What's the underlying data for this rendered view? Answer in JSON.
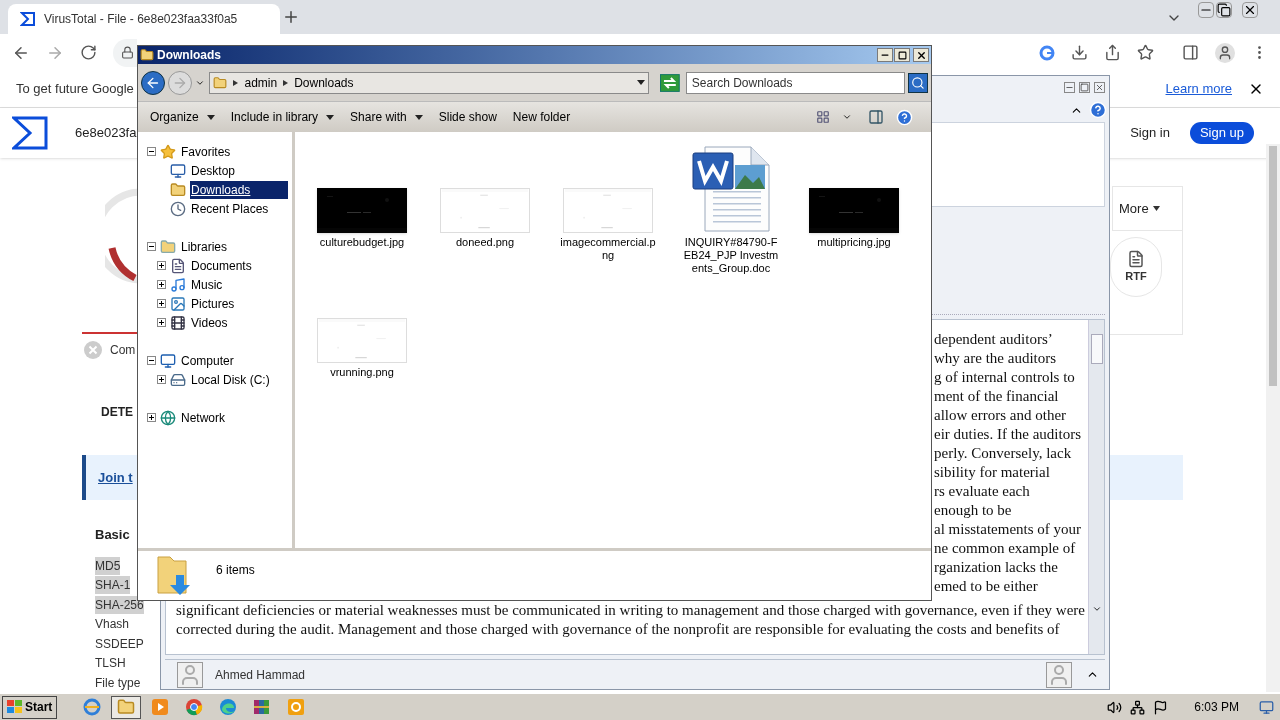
{
  "browser": {
    "tab_title": "VirusTotal - File - 6e8e023faa33f0a5",
    "infobar": {
      "message": "To get future Google",
      "link": "Learn more"
    },
    "page": {
      "file_hash": "6e8e023fa",
      "sign_in": "Sign in",
      "sign_up": "Sign up",
      "more_menu": "More",
      "file_type_badge": "RTF",
      "community_label": "Com",
      "detection_tab": "DETE",
      "join_link": "Join t",
      "section_title": "Basic",
      "fields": [
        {
          "label": "MD5",
          "highlighted": true
        },
        {
          "label": "SHA-1",
          "highlighted": true
        },
        {
          "label": "SHA-256",
          "highlighted": true
        },
        {
          "label": "Vhash",
          "highlighted": false
        },
        {
          "label": "SSDEEP",
          "highlighted": false
        },
        {
          "label": "TLSH",
          "highlighted": false
        },
        {
          "label": "File type",
          "highlighted": false
        }
      ]
    }
  },
  "document_window": {
    "partial_lines": [
      "dependent auditors’",
      "why are the auditors",
      "g of internal controls to",
      "ment of the financial",
      "allow errors and other",
      "eir duties. If the auditors",
      "perly. Conversely, lack",
      "sibility for material",
      "rs evaluate each",
      "enough to be",
      "al misstatements of your",
      "ne common example of",
      "rganization lacks the",
      "emed to be either"
    ],
    "lines": [
      "significant deficiencies or material weaknesses must be communicated in writing to management and those charged with governance, even if they were",
      "corrected during the audit. Management and those charged with governance of the nonprofit are responsible for evaluating the costs and benefits of"
    ],
    "author": "Ahmed Hammad"
  },
  "explorer": {
    "title": "Downloads",
    "breadcrumb": [
      "admin",
      "Downloads"
    ],
    "search": {
      "placeholder": "Search Downloads"
    },
    "toolbar": [
      {
        "label": "Organize",
        "dropdown": true
      },
      {
        "label": "Include in library",
        "dropdown": true
      },
      {
        "label": "Share with",
        "dropdown": true
      },
      {
        "label": "Slide show",
        "dropdown": false
      },
      {
        "label": "New folder",
        "dropdown": false
      }
    ],
    "nav": [
      {
        "label": "Favorites",
        "expanded": true,
        "selected": false,
        "children": [
          {
            "label": "Desktop",
            "selected": false
          },
          {
            "label": "Downloads",
            "selected": true
          },
          {
            "label": "Recent Places",
            "selected": false
          }
        ]
      },
      {
        "label": "Libraries",
        "expanded": true,
        "selected": false,
        "children": [
          {
            "label": "Documents",
            "expanded": false,
            "selected": false
          },
          {
            "label": "Music",
            "expanded": false,
            "selected": false
          },
          {
            "label": "Pictures",
            "expanded": false,
            "selected": false
          },
          {
            "label": "Videos",
            "expanded": false,
            "selected": false
          }
        ]
      },
      {
        "label": "Computer",
        "expanded": true,
        "selected": false,
        "children": [
          {
            "label": "Local Disk (C:)",
            "expanded": false,
            "selected": false
          }
        ]
      },
      {
        "label": "Network",
        "expanded": false,
        "selected": false
      }
    ],
    "files": [
      {
        "name": "culturebudget.jpg",
        "kind": "dark_image"
      },
      {
        "name": "doneed.png",
        "kind": "light_image"
      },
      {
        "name": "imagecommercial.png",
        "kind": "light_image"
      },
      {
        "name": "INQUIRY#84790-FEB24_PJP Investments_Group.doc",
        "kind": "document"
      },
      {
        "name": "multipricing.jpg",
        "kind": "dark_image"
      },
      {
        "name": "vrunning.png",
        "kind": "light_image"
      }
    ],
    "status": "6 items"
  },
  "taskbar": {
    "start": "Start",
    "apps": [
      {
        "active": false
      },
      {
        "active": true
      },
      {
        "active": false
      },
      {
        "active": false
      },
      {
        "active": false
      },
      {
        "active": false
      },
      {
        "active": false
      }
    ],
    "clock": "6:03 PM"
  }
}
